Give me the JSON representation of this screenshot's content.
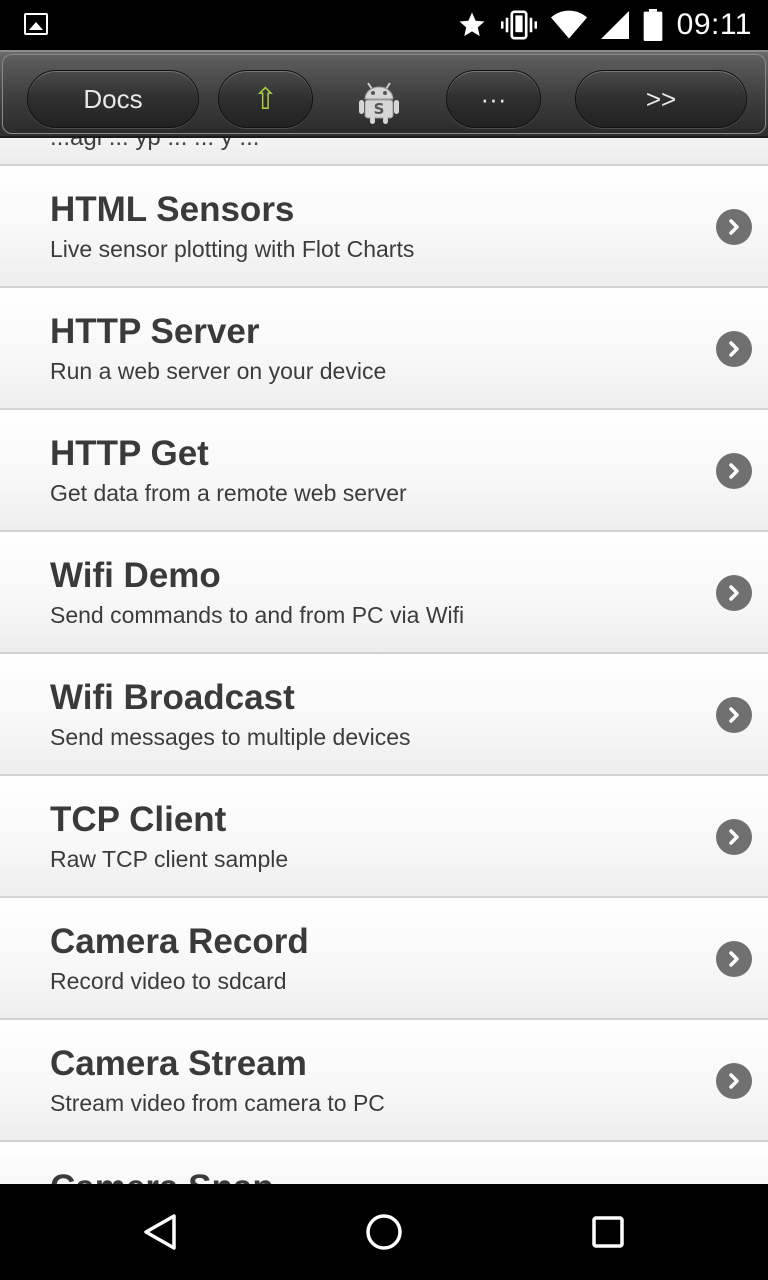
{
  "status_bar": {
    "time": "09:11",
    "icons": [
      "image-icon",
      "star-icon",
      "vibrate-icon",
      "wifi-icon",
      "cell-signal-icon",
      "battery-icon"
    ]
  },
  "toolbar": {
    "docs_label": "Docs",
    "up_label": "⇧",
    "more_label": "···",
    "next_label": ">>",
    "logo": "android-s-logo"
  },
  "list": {
    "partial_top_text": "...agi ... yp ... ... y ...",
    "items": [
      {
        "title": "HTML Sensors",
        "subtitle": "Live sensor plotting with Flot Charts"
      },
      {
        "title": "HTTP Server",
        "subtitle": "Run a web server on your device"
      },
      {
        "title": "HTTP Get",
        "subtitle": "Get data from a remote web server"
      },
      {
        "title": "Wifi Demo",
        "subtitle": "Send commands to and from PC via Wifi"
      },
      {
        "title": "Wifi Broadcast",
        "subtitle": "Send messages to multiple devices"
      },
      {
        "title": "TCP Client",
        "subtitle": "Raw TCP client sample"
      },
      {
        "title": "Camera Record",
        "subtitle": "Record video to sdcard"
      },
      {
        "title": "Camera Stream",
        "subtitle": "Stream video from camera to PC"
      }
    ],
    "partial_bottom_title": "Camera Snap"
  },
  "nav_bar": {
    "buttons": [
      "back-icon",
      "home-icon",
      "recents-icon"
    ]
  }
}
